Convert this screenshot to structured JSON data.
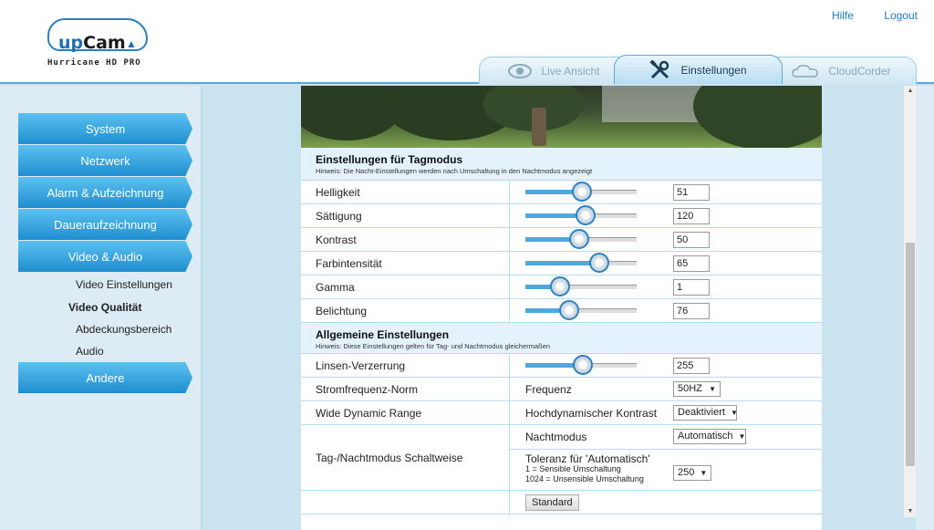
{
  "header": {
    "logo_brand_up": "up",
    "logo_brand_cam": "Cam",
    "logo_sub": "Hurricane HD PRO",
    "links": {
      "help": "Hilfe",
      "logout": "Logout"
    }
  },
  "tabs": {
    "live": "Live Ansicht",
    "settings": "Einstellungen",
    "cloud": "CloudCorder",
    "active": "settings"
  },
  "sidebar": {
    "items": [
      "System",
      "Netzwerk",
      "Alarm & Aufzeichnung",
      "Daueraufzeichnung",
      "Video & Audio"
    ],
    "sub_items": [
      "Video Einstellungen",
      "Video Qualität",
      "Abdeckungsbereich",
      "Audio"
    ],
    "active_sub": "Video Qualität",
    "last_item": "Andere"
  },
  "day_mode": {
    "title": "Einstellungen für Tagmodus",
    "note": "Hinweis: Die Nacht-Einstellungen werden nach Umschaltung in den Nachtmodus angezeigt",
    "rows": [
      {
        "label": "Helligkeit",
        "value": "51",
        "level": 0.51
      },
      {
        "label": "Sättigung",
        "value": "120",
        "level": 0.54
      },
      {
        "label": "Kontrast",
        "value": "50",
        "level": 0.48
      },
      {
        "label": "Farbintensität",
        "value": "65",
        "level": 0.66
      },
      {
        "label": "Gamma",
        "value": "1",
        "level": 0.31
      },
      {
        "label": "Belichtung",
        "value": "76",
        "level": 0.39
      }
    ]
  },
  "general": {
    "title": "Allgemeine Einstellungen",
    "note": "Hinweis: Diese Einstellungen gelten für Tag- und Nachtmodus gleichermaßen",
    "lens": {
      "label": "Linsen-Verzerrung",
      "value": "255",
      "level": 0.52
    },
    "power": {
      "label": "Stromfrequenz-Norm",
      "field": "Frequenz",
      "selected": "50HZ"
    },
    "wdr": {
      "label": "Wide Dynamic Range",
      "field": "Hochdynamischer Kontrast",
      "selected": "Deaktiviert"
    },
    "daynight": {
      "label": "Tag-/Nachtmodus Schaltweise",
      "mode_field": "Nachtmodus",
      "mode_selected": "Automatisch",
      "tol_title": "Toleranz für 'Automatisch'",
      "tol_line1": "1 = Sensible Umschaltung",
      "tol_line2": "1024 = Unsensible Umschaltung",
      "tol_selected": "250"
    },
    "standard_button": "Standard"
  }
}
